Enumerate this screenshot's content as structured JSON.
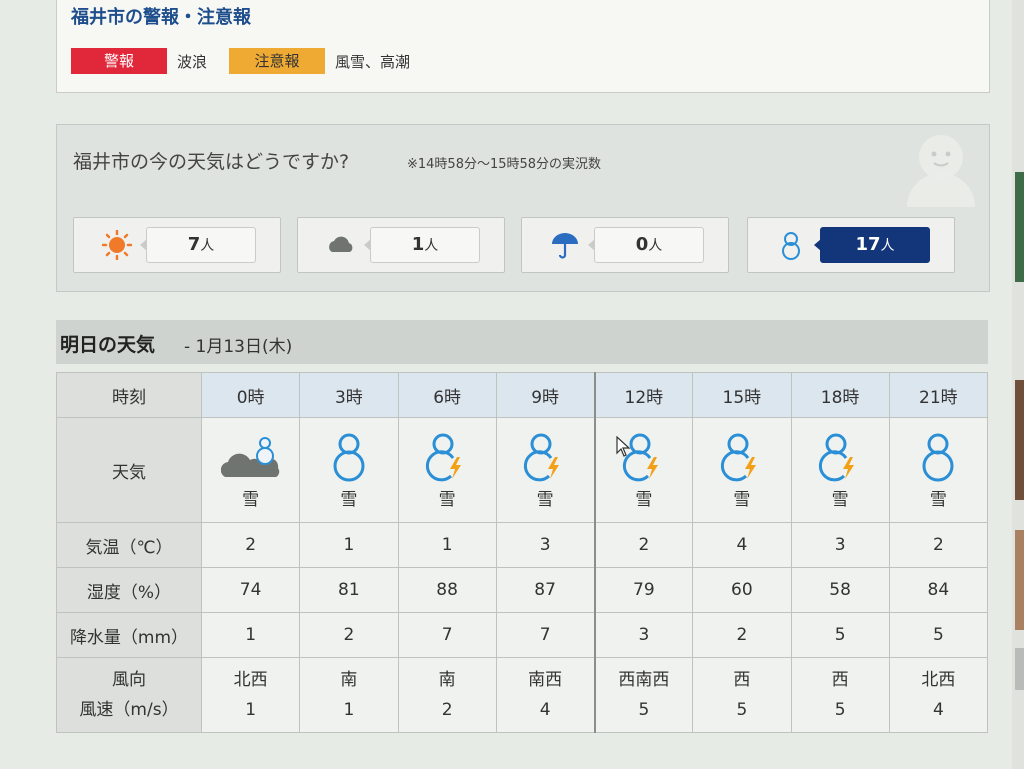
{
  "warnings": {
    "title": "福井市の警報・注意報",
    "warning_label": "警報",
    "warning_items": "波浪",
    "advisory_label": "注意報",
    "advisory_items": "風雪、高潮",
    "colors": {
      "warning": "#e0283a",
      "advisory": "#eeaa32"
    }
  },
  "now": {
    "question": "福井市の今の天気はどうですか?",
    "note": "※14時58分〜15時58分の実況数",
    "votes": [
      {
        "icon": "sun-icon",
        "count": "7",
        "unit": "人"
      },
      {
        "icon": "cloud-icon",
        "count": "1",
        "unit": "人"
      },
      {
        "icon": "umbrella-icon",
        "count": "0",
        "unit": "人"
      },
      {
        "icon": "snowman-icon",
        "count": "17",
        "unit": "人",
        "selected": true
      }
    ]
  },
  "tomorrow": {
    "title": "明日の天気",
    "date": "- 1月13日(木)",
    "labels": {
      "time": "時刻",
      "weather": "天気",
      "temp": "気温（℃）",
      "humidity": "湿度（%）",
      "precip": "降水量（mm）",
      "wind_dir": "風向",
      "wind_speed": "風速（m/s）"
    },
    "times": [
      "0時",
      "3時",
      "6時",
      "9時",
      "12時",
      "15時",
      "18時",
      "21時"
    ],
    "weather_icons": [
      "cloud-snowman-icon",
      "snowman-icon",
      "snowman-thunder-icon",
      "snowman-thunder-icon",
      "snowman-thunder-icon",
      "snowman-thunder-icon",
      "snowman-thunder-icon",
      "snowman-icon"
    ],
    "weather": [
      "雪",
      "雪",
      "雪",
      "雪",
      "雪",
      "雪",
      "雪",
      "雪"
    ],
    "temp": [
      "2",
      "1",
      "1",
      "3",
      "2",
      "4",
      "3",
      "2"
    ],
    "humidity": [
      "74",
      "81",
      "88",
      "87",
      "79",
      "60",
      "58",
      "84"
    ],
    "precip": [
      "1",
      "2",
      "7",
      "7",
      "3",
      "2",
      "5",
      "5"
    ],
    "wind_dir": [
      "北西",
      "南",
      "南",
      "南西",
      "西南西",
      "西",
      "西",
      "北西"
    ],
    "wind_speed": [
      "1",
      "1",
      "2",
      "4",
      "5",
      "5",
      "5",
      "4"
    ]
  }
}
